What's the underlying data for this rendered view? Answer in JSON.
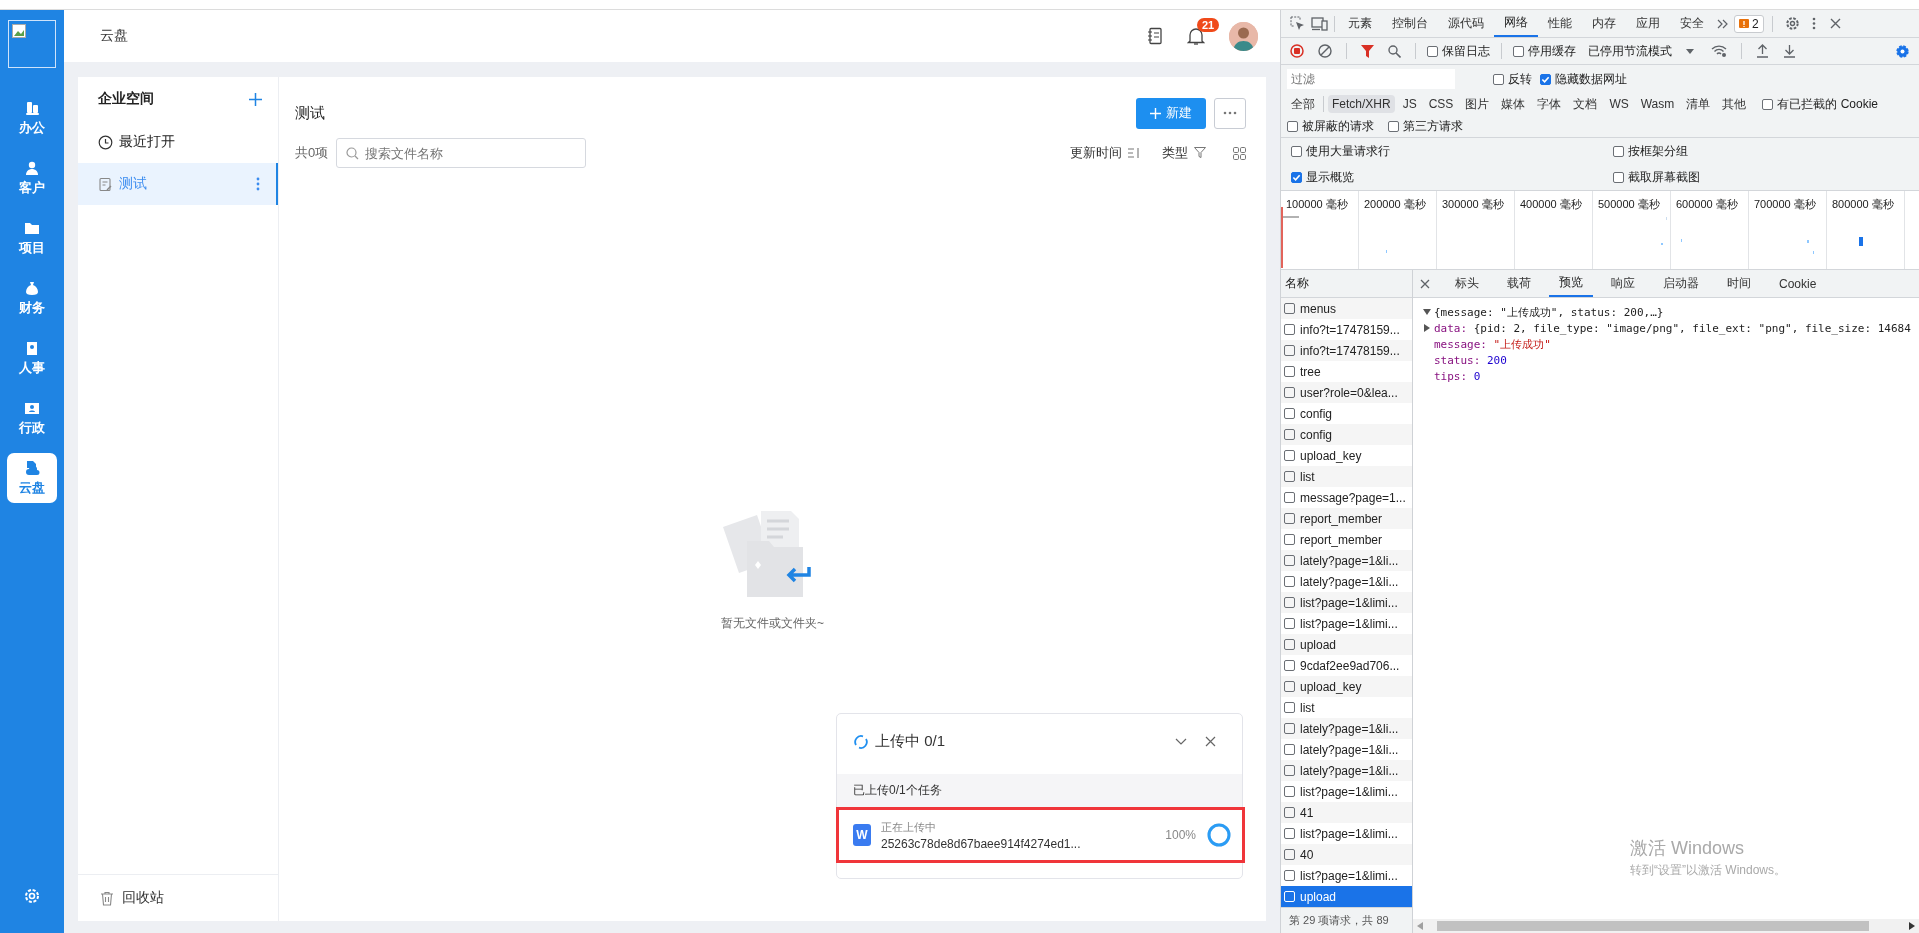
{
  "app": {
    "nav": {
      "items": [
        {
          "label": "办公",
          "selected": false
        },
        {
          "label": "客户",
          "selected": false
        },
        {
          "label": "项目",
          "selected": false
        },
        {
          "label": "财务",
          "selected": false
        },
        {
          "label": "人事",
          "selected": false
        },
        {
          "label": "行政",
          "selected": false
        },
        {
          "label": "云盘",
          "selected": true
        }
      ]
    },
    "header": {
      "title": "云盘",
      "notification_count": "21"
    },
    "sidebar": {
      "title": "企业空间",
      "items": [
        {
          "label": "最近打开",
          "kind": "recent",
          "selected": false
        },
        {
          "label": "测试",
          "kind": "folder",
          "selected": true
        }
      ],
      "trash": "回收站"
    },
    "content": {
      "title": "测试",
      "new_button": "新建",
      "count": "共0项",
      "search": {
        "placeholder": "搜索文件名称"
      },
      "sort": "更新时间",
      "type_filter": "类型",
      "empty_text": "暂无文件或文件夹~"
    },
    "upload_panel": {
      "title": "上传中 0/1",
      "summary": "已上传0/1个任务",
      "items": [
        {
          "status": "正在上传中",
          "file_badge": "W",
          "name": "25263c78de8d67baee914f4274ed1...",
          "percent": "100%",
          "level": 1,
          "highlighted": true
        }
      ]
    }
  },
  "devtools": {
    "tabs": [
      {
        "label": "元素",
        "selected": false
      },
      {
        "label": "控制台",
        "selected": false
      },
      {
        "label": "源代码",
        "selected": false
      },
      {
        "label": "网络",
        "selected": true
      },
      {
        "label": "性能",
        "selected": false
      },
      {
        "label": "内存",
        "selected": false
      },
      {
        "label": "应用",
        "selected": false
      },
      {
        "label": "安全",
        "selected": false
      }
    ],
    "issues_count": "2",
    "toolbar": {
      "preserve_log": {
        "label": "保留日志",
        "checked": false
      },
      "disable_cache": {
        "label": "停用缓存",
        "checked": false
      },
      "throttling": "已停用节流模式"
    },
    "filter": {
      "placeholder": "过滤",
      "invert": {
        "label": "反转",
        "checked": false
      },
      "hide_data_urls": {
        "label": "隐藏数据网址",
        "checked": true
      }
    },
    "type_filters": [
      {
        "label": "全部",
        "selected": false
      },
      {
        "label": "Fetch/XHR",
        "selected": true
      },
      {
        "label": "JS",
        "selected": false
      },
      {
        "label": "CSS",
        "selected": false
      },
      {
        "label": "图片",
        "selected": false
      },
      {
        "label": "媒体",
        "selected": false
      },
      {
        "label": "字体",
        "selected": false
      },
      {
        "label": "文档",
        "selected": false
      },
      {
        "label": "WS",
        "selected": false
      },
      {
        "label": "Wasm",
        "selected": false
      },
      {
        "label": "清单",
        "selected": false
      },
      {
        "label": "其他",
        "selected": false
      }
    ],
    "blocked_cookies": {
      "label": "有已拦截的 Cookie",
      "checked": false
    },
    "extra_filters": [
      {
        "label": "被屏蔽的请求",
        "checked": false
      },
      {
        "label": "第三方请求",
        "checked": false
      }
    ],
    "options": [
      {
        "label": "使用大量请求行",
        "checked": false
      },
      {
        "label": "按框架分组",
        "checked": false
      },
      {
        "label": "显示概览",
        "checked": true
      },
      {
        "label": "截取屏幕截图",
        "checked": false
      }
    ],
    "timeline_labels": [
      "100000 毫秒",
      "200000 毫秒",
      "300000 毫秒",
      "400000 毫秒",
      "500000 毫秒",
      "600000 毫秒",
      "700000 毫秒",
      "800000 毫秒"
    ],
    "requests": {
      "column": "名称",
      "rows": [
        {
          "name": "menus",
          "selected": false
        },
        {
          "name": "info?t=17478159...",
          "selected": false
        },
        {
          "name": "info?t=17478159...",
          "selected": false
        },
        {
          "name": "tree",
          "selected": false
        },
        {
          "name": "user?role=0&lea...",
          "selected": false
        },
        {
          "name": "config",
          "selected": false
        },
        {
          "name": "config",
          "selected": false
        },
        {
          "name": "upload_key",
          "selected": false
        },
        {
          "name": "list",
          "selected": false
        },
        {
          "name": "message?page=1...",
          "selected": false
        },
        {
          "name": "report_member",
          "selected": false
        },
        {
          "name": "report_member",
          "selected": false
        },
        {
          "name": "lately?page=1&li...",
          "selected": false
        },
        {
          "name": "lately?page=1&li...",
          "selected": false
        },
        {
          "name": "list?page=1&limi...",
          "selected": false
        },
        {
          "name": "list?page=1&limi...",
          "selected": false
        },
        {
          "name": "upload",
          "selected": false
        },
        {
          "name": "9cdaf2ee9ad706...",
          "selected": false
        },
        {
          "name": "upload_key",
          "selected": false
        },
        {
          "name": "list",
          "selected": false
        },
        {
          "name": "lately?page=1&li...",
          "selected": false
        },
        {
          "name": "lately?page=1&li...",
          "selected": false
        },
        {
          "name": "lately?page=1&li...",
          "selected": false
        },
        {
          "name": "list?page=1&limi...",
          "selected": false
        },
        {
          "name": "41",
          "selected": false
        },
        {
          "name": "list?page=1&limi...",
          "selected": false
        },
        {
          "name": "40",
          "selected": false
        },
        {
          "name": "list?page=1&limi...",
          "selected": false
        },
        {
          "name": "upload",
          "selected": true
        }
      ],
      "footer": "第 29 项请求，共 89"
    },
    "detail_tabs": [
      {
        "label": "标头",
        "selected": false
      },
      {
        "label": "载荷",
        "selected": false
      },
      {
        "label": "预览",
        "selected": true
      },
      {
        "label": "响应",
        "selected": false
      },
      {
        "label": "启动器",
        "selected": false
      },
      {
        "label": "时间",
        "selected": false
      },
      {
        "label": "Cookie",
        "selected": false
      }
    ],
    "preview": {
      "summary": {
        "text": "{message: \"上传成功\", status: 200,…}",
        "expanded": true
      },
      "fields": [
        {
          "key": "data:",
          "value": "{pid: 2, file_type: \"image/png\", file_ext: \"png\", file_size: 14684",
          "kind": "object",
          "expanded": false
        },
        {
          "key": "message:",
          "value": "\"上传成功\"",
          "kind": "string"
        },
        {
          "key": "status:",
          "value": "200",
          "kind": "number"
        },
        {
          "key": "tips:",
          "value": "0",
          "kind": "number"
        }
      ]
    }
  },
  "os_notice": {
    "title": "激活 Windows",
    "text": "转到“设置”以激活 Windows。"
  }
}
